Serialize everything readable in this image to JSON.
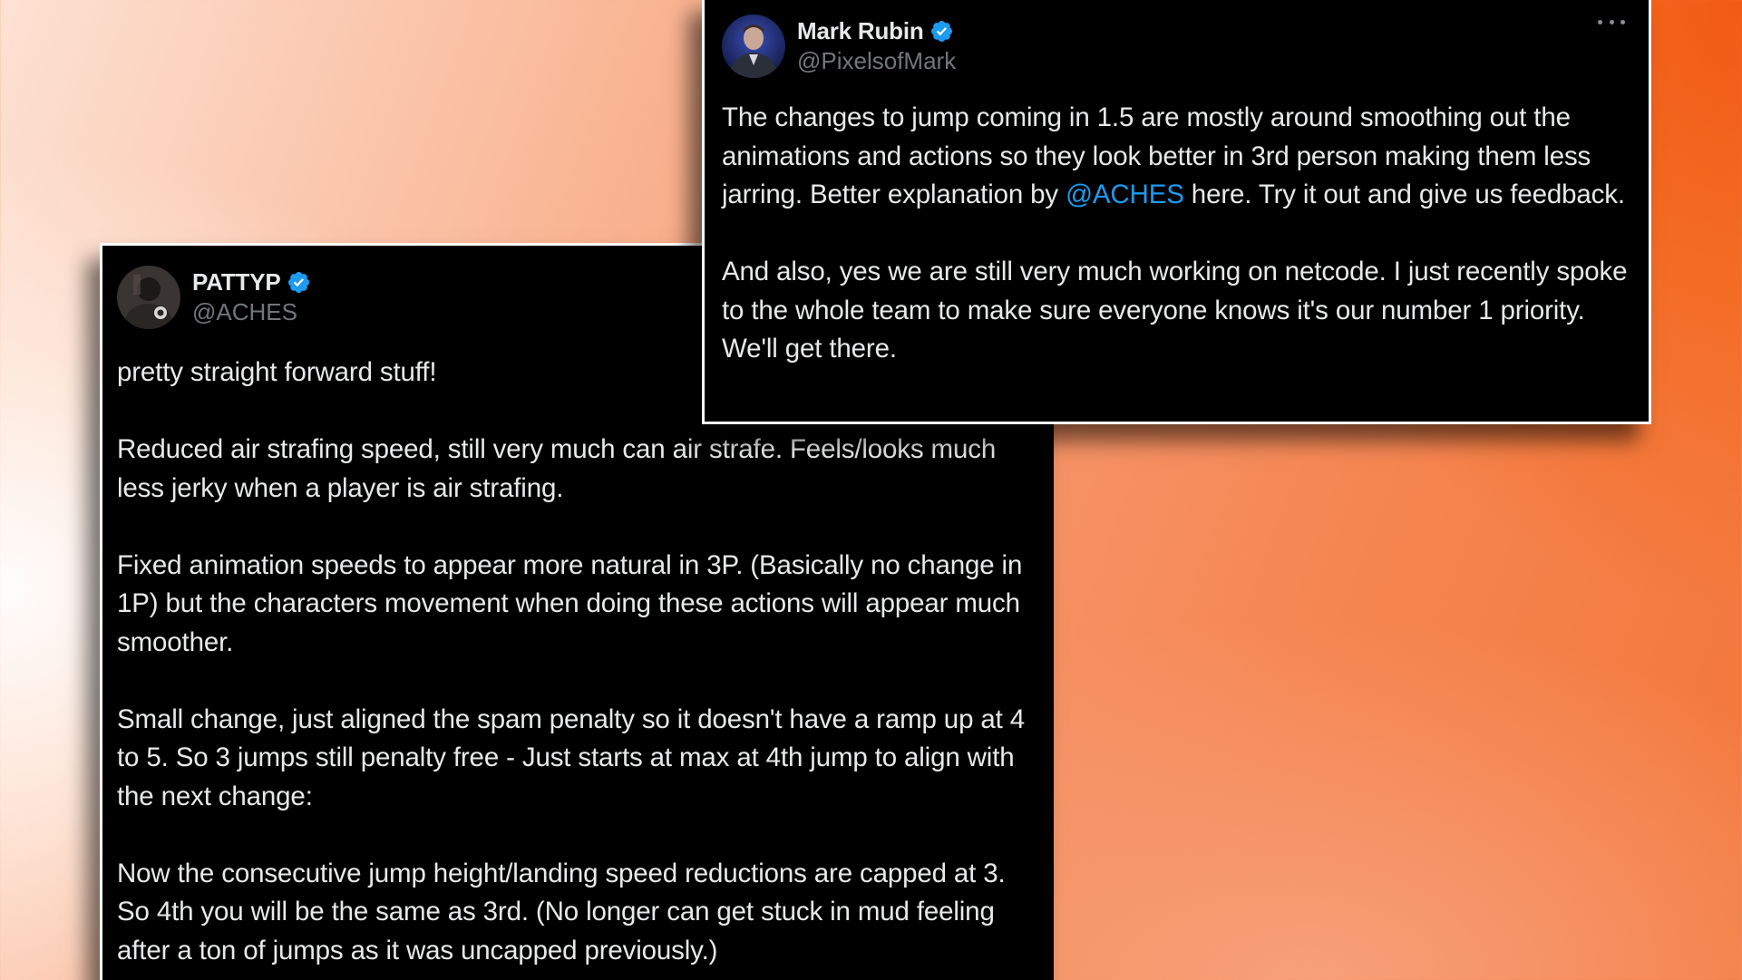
{
  "posts": [
    {
      "display_name": "PATTYP",
      "handle": "@ACHES",
      "verified": true,
      "avatar": "profile-photo",
      "paragraphs": [
        "pretty straight forward stuff!",
        "Reduced air strafing speed, still very much can air strafe. Feels/looks much less jerky when a player is air strafing.",
        "Fixed animation speeds to appear more natural in 3P. (Basically no change in 1P) but the characters movement when doing these actions will appear much smoother.",
        "Small change, just aligned the spam penalty so it doesn't have a ramp up at 4 to 5. So 3 jumps still penalty free - Just starts at max at 4th jump to align with the next change:",
        "Now the consecutive jump height/landing speed reductions are capped at 3. So 4th you will be the same as 3rd. (No longer can get stuck in mud feeling after a ton of jumps as it was uncapped previously.)"
      ]
    },
    {
      "display_name": "Mark Rubin",
      "handle": "@PixelsofMark",
      "verified": true,
      "avatar": "profile-photo",
      "paragraph1_before": "The changes to jump coming in 1.5 are mostly around smoothing out the animations and actions so they look better in 3rd person making them less jarring. Better explanation by ",
      "paragraph1_mention": "@ACHES",
      "paragraph1_after": " here. Try it out and give us feedback.",
      "paragraph2": "And also, yes we are still very much working on netcode. I just recently spoke to the whole team to make sure everyone knows it's our number 1 priority. We'll get there.",
      "more_icon": "more-options-icon"
    }
  ],
  "colors": {
    "card_bg": "#000000",
    "text": "#e7e9ea",
    "handle": "#71767b",
    "mention": "#1d9bf0",
    "verified": "#1d9bf0"
  }
}
